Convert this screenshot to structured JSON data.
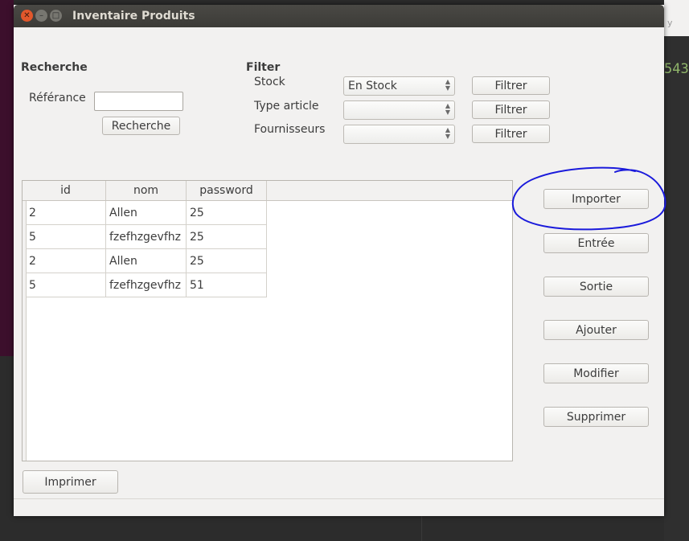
{
  "window": {
    "title": "Inventaire Produits"
  },
  "background": {
    "right_text": "543",
    "right_tiny": "y"
  },
  "search": {
    "heading": "Recherche",
    "reference_label": "Référance",
    "reference_value": "",
    "button": "Recherche"
  },
  "filter": {
    "heading": "Filter",
    "rows": [
      {
        "label": "Stock",
        "value": "En Stock",
        "button": "Filtrer"
      },
      {
        "label": "Type article",
        "value": "",
        "button": "Filtrer"
      },
      {
        "label": "Fournisseurs",
        "value": "",
        "button": "Filtrer"
      }
    ]
  },
  "table": {
    "columns": [
      "id",
      "nom",
      "password"
    ],
    "rows": [
      [
        "2",
        "Allen",
        "25"
      ],
      [
        "5",
        "fzefhzgevfhz",
        "25"
      ],
      [
        "2",
        "Allen",
        "25"
      ],
      [
        "5",
        "fzefhzgevfhz",
        "51"
      ]
    ]
  },
  "actions": {
    "importer": "Importer",
    "entree": "Entrée",
    "sortie": "Sortie",
    "ajouter": "Ajouter",
    "modifier": "Modifier",
    "supprimer": "Supprimer"
  },
  "footer": {
    "print_button": "Imprimer"
  },
  "annotation": {
    "color": "#1a1adb"
  }
}
